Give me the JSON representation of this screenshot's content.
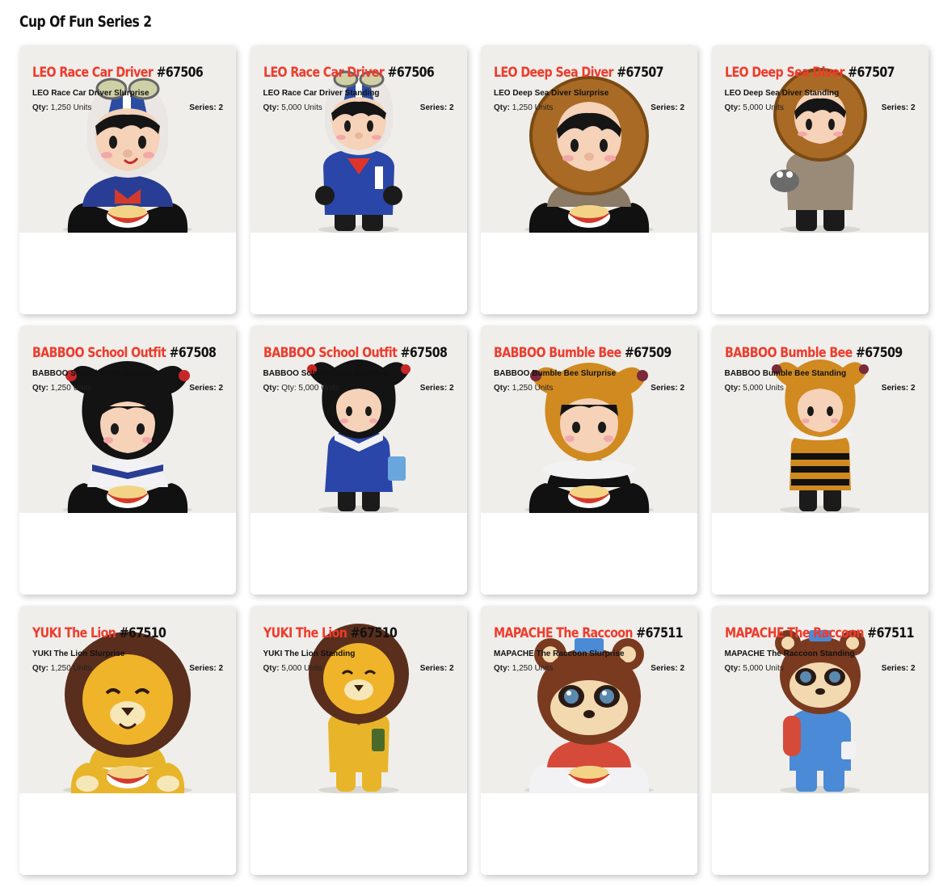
{
  "page": {
    "title": "Cup Of Fun Series 2"
  },
  "labels": {
    "qty": "Qty:",
    "series": "Series:"
  },
  "cards": [
    {
      "name": "LEO Race Car Driver",
      "number": "#67506",
      "subtitle": "LEO Race Car Driver Slurprise",
      "qty": "1,250 Units",
      "series": "2",
      "figure": "leo-race-sitting-figure"
    },
    {
      "name": "LEO Race Car Driver",
      "number": "#67506",
      "subtitle": "LEO Race Car Driver Standing",
      "qty": "5,000 Units",
      "series": "2",
      "figure": "leo-race-standing-figure"
    },
    {
      "name": "LEO Deep Sea Diver",
      "number": "#67507",
      "subtitle": "LEO Deep Sea Diver Slurprise",
      "qty": "1,250 Units",
      "series": "2",
      "figure": "leo-diver-sitting-figure"
    },
    {
      "name": "LEO Deep Sea Diver",
      "number": "#67507",
      "subtitle": "LEO Deep Sea Diver Standing",
      "qty": "5,000 Units",
      "series": "2",
      "figure": "leo-diver-standing-figure"
    },
    {
      "name": "BABBOO School Outfit",
      "number": "#67508",
      "subtitle": "BABBOO School Outfit Slurprise",
      "qty": "1,250 Units",
      "series": "2",
      "figure": "babboo-school-sitting-figure"
    },
    {
      "name": "BABBOO School Outfit",
      "number": "#67508",
      "subtitle": "BABBOO School Outfit Standing",
      "qty": "Qty: 5,000 Units",
      "series": "2",
      "figure": "babboo-school-standing-figure"
    },
    {
      "name": "BABBOO Bumble Bee",
      "number": "#67509",
      "subtitle": "BABBOO Bumble Bee Slurprise",
      "qty": "1,250 Units",
      "series": "2",
      "figure": "babboo-bee-sitting-figure"
    },
    {
      "name": "BABBOO Bumble Bee",
      "number": "#67509",
      "subtitle": "BABBOO Bumble Bee Standing",
      "qty": "5,000 Units",
      "series": "2",
      "figure": "babboo-bee-standing-figure"
    },
    {
      "name": "YUKI The Lion",
      "number": "#67510",
      "subtitle": "YUKI The Lion Slurprise",
      "qty": "1,250 Units",
      "series": "2",
      "figure": "yuki-lion-sitting-figure"
    },
    {
      "name": "YUKI The Lion",
      "number": "#67510",
      "subtitle": "YUKI The Lion Standing",
      "qty": "5,000 Units",
      "series": "2",
      "figure": "yuki-lion-standing-figure"
    },
    {
      "name": "MAPACHE The Raccoon",
      "number": "#67511",
      "subtitle": "MAPACHE The Raccoon Slurprise",
      "qty": "1,250 Units",
      "series": "2",
      "figure": "mapache-raccoon-sitting-figure"
    },
    {
      "name": "MAPACHE The Raccoon",
      "number": "#67511",
      "subtitle": "MAPACHE The Raccoon Standing",
      "qty": "5,000 Units",
      "series": "2",
      "figure": "mapache-raccoon-standing-figure"
    }
  ],
  "colors": {
    "accent": "#ef3b2c",
    "photo_bg": "#efeeea"
  }
}
